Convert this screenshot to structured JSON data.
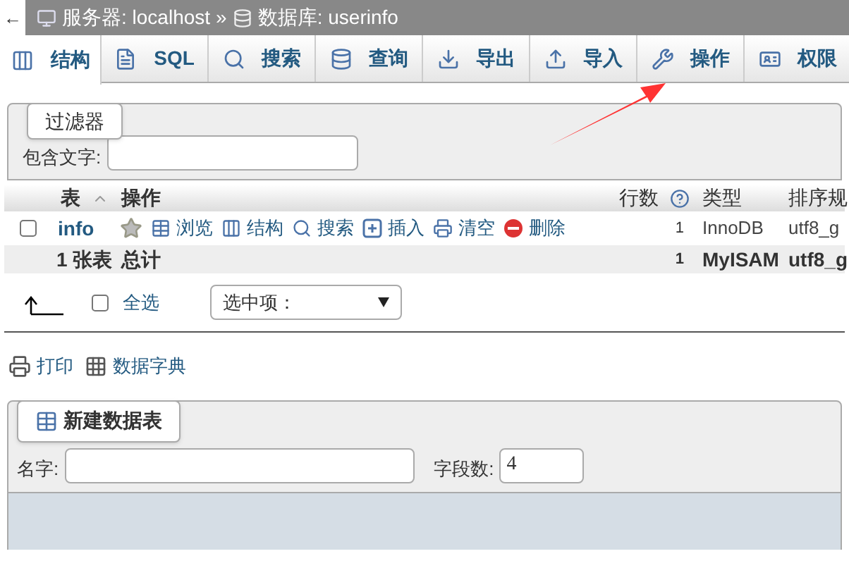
{
  "back_button": "←",
  "breadcrumb": [
    {
      "kind": "server",
      "label": "服务器: localhost"
    },
    {
      "kind": "separator",
      "label": "»"
    },
    {
      "kind": "database",
      "label": "数据库: userinfo"
    }
  ],
  "tabs": [
    {
      "label": "结构",
      "selected": true
    },
    {
      "label": "SQL",
      "selected": false
    },
    {
      "label": "搜索",
      "selected": false
    },
    {
      "label": "查询",
      "selected": false
    },
    {
      "label": "导出",
      "selected": false
    },
    {
      "label": "导入",
      "selected": false
    },
    {
      "label": "操作",
      "selected": false
    },
    {
      "label": "权限",
      "selected": false
    }
  ],
  "filter": {
    "legend": "过滤器",
    "label": "包含文字:"
  },
  "table": {
    "columns": [
      "表",
      "操作",
      "行数",
      "类型",
      "排序规"
    ],
    "rows": [
      {
        "checked": false,
        "name": "info",
        "actions": [
          "浏览",
          "结构",
          "搜索",
          "插入",
          "清空",
          "删除"
        ],
        "rows": "1",
        "type": "InnoDB",
        "collation": "utf8_g"
      }
    ],
    "total": {
      "tables": "1 张表",
      "label": "总计",
      "rows": "1",
      "type": "MyISAM",
      "collation": "utf8_g"
    }
  },
  "bulk": {
    "select_all": "全选",
    "checked": false,
    "dropdown": "选中项："
  },
  "links": [
    "打印",
    "数据字典"
  ],
  "create_table": {
    "legend": "新建数据表",
    "name_label": "名字:",
    "fields_label": "字段数:",
    "fields_value": "4"
  }
}
